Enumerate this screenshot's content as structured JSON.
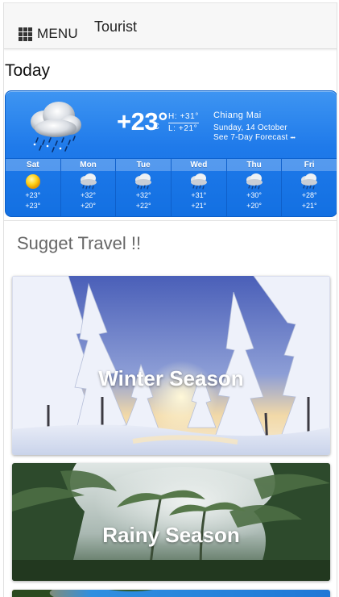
{
  "header": {
    "menu_label": "MENU",
    "title": "Tourist",
    "menu_icon": "grid-icon"
  },
  "section_title": "Today",
  "weather": {
    "temperature": "+23°",
    "unit": "C",
    "high": "H: +31°",
    "low": "L: +21°",
    "location": "Chiang Mai",
    "date": "Sunday, 14 October",
    "forecast_link": "See 7-Day Forecast ",
    "forecast_more": "•••",
    "current_icon": "rain-cloud-icon",
    "days": [
      {
        "name": "Sat",
        "icon": "sun-icon",
        "high": "+23°",
        "low": "+23°"
      },
      {
        "name": "Mon",
        "icon": "rain-cloud-icon",
        "high": "+32°",
        "low": "+20°"
      },
      {
        "name": "Tue",
        "icon": "rain-cloud-icon",
        "high": "+32°",
        "low": "+22°"
      },
      {
        "name": "Wed",
        "icon": "rain-cloud-icon",
        "high": "+31°",
        "low": "+21°"
      },
      {
        "name": "Thu",
        "icon": "rain-cloud-icon",
        "high": "+30°",
        "low": "+20°"
      },
      {
        "name": "Fri",
        "icon": "rain-cloud-icon",
        "high": "+28°",
        "low": "+21°"
      }
    ]
  },
  "suggest_title": "Sugget Travel !!",
  "cards": [
    {
      "title": "Winter Season"
    },
    {
      "title": "Rainy Season"
    }
  ],
  "colors": {
    "widget_blue": "#1f7aea",
    "widget_border": "#0b5fc9",
    "header_bg": "#f7f7f7"
  }
}
